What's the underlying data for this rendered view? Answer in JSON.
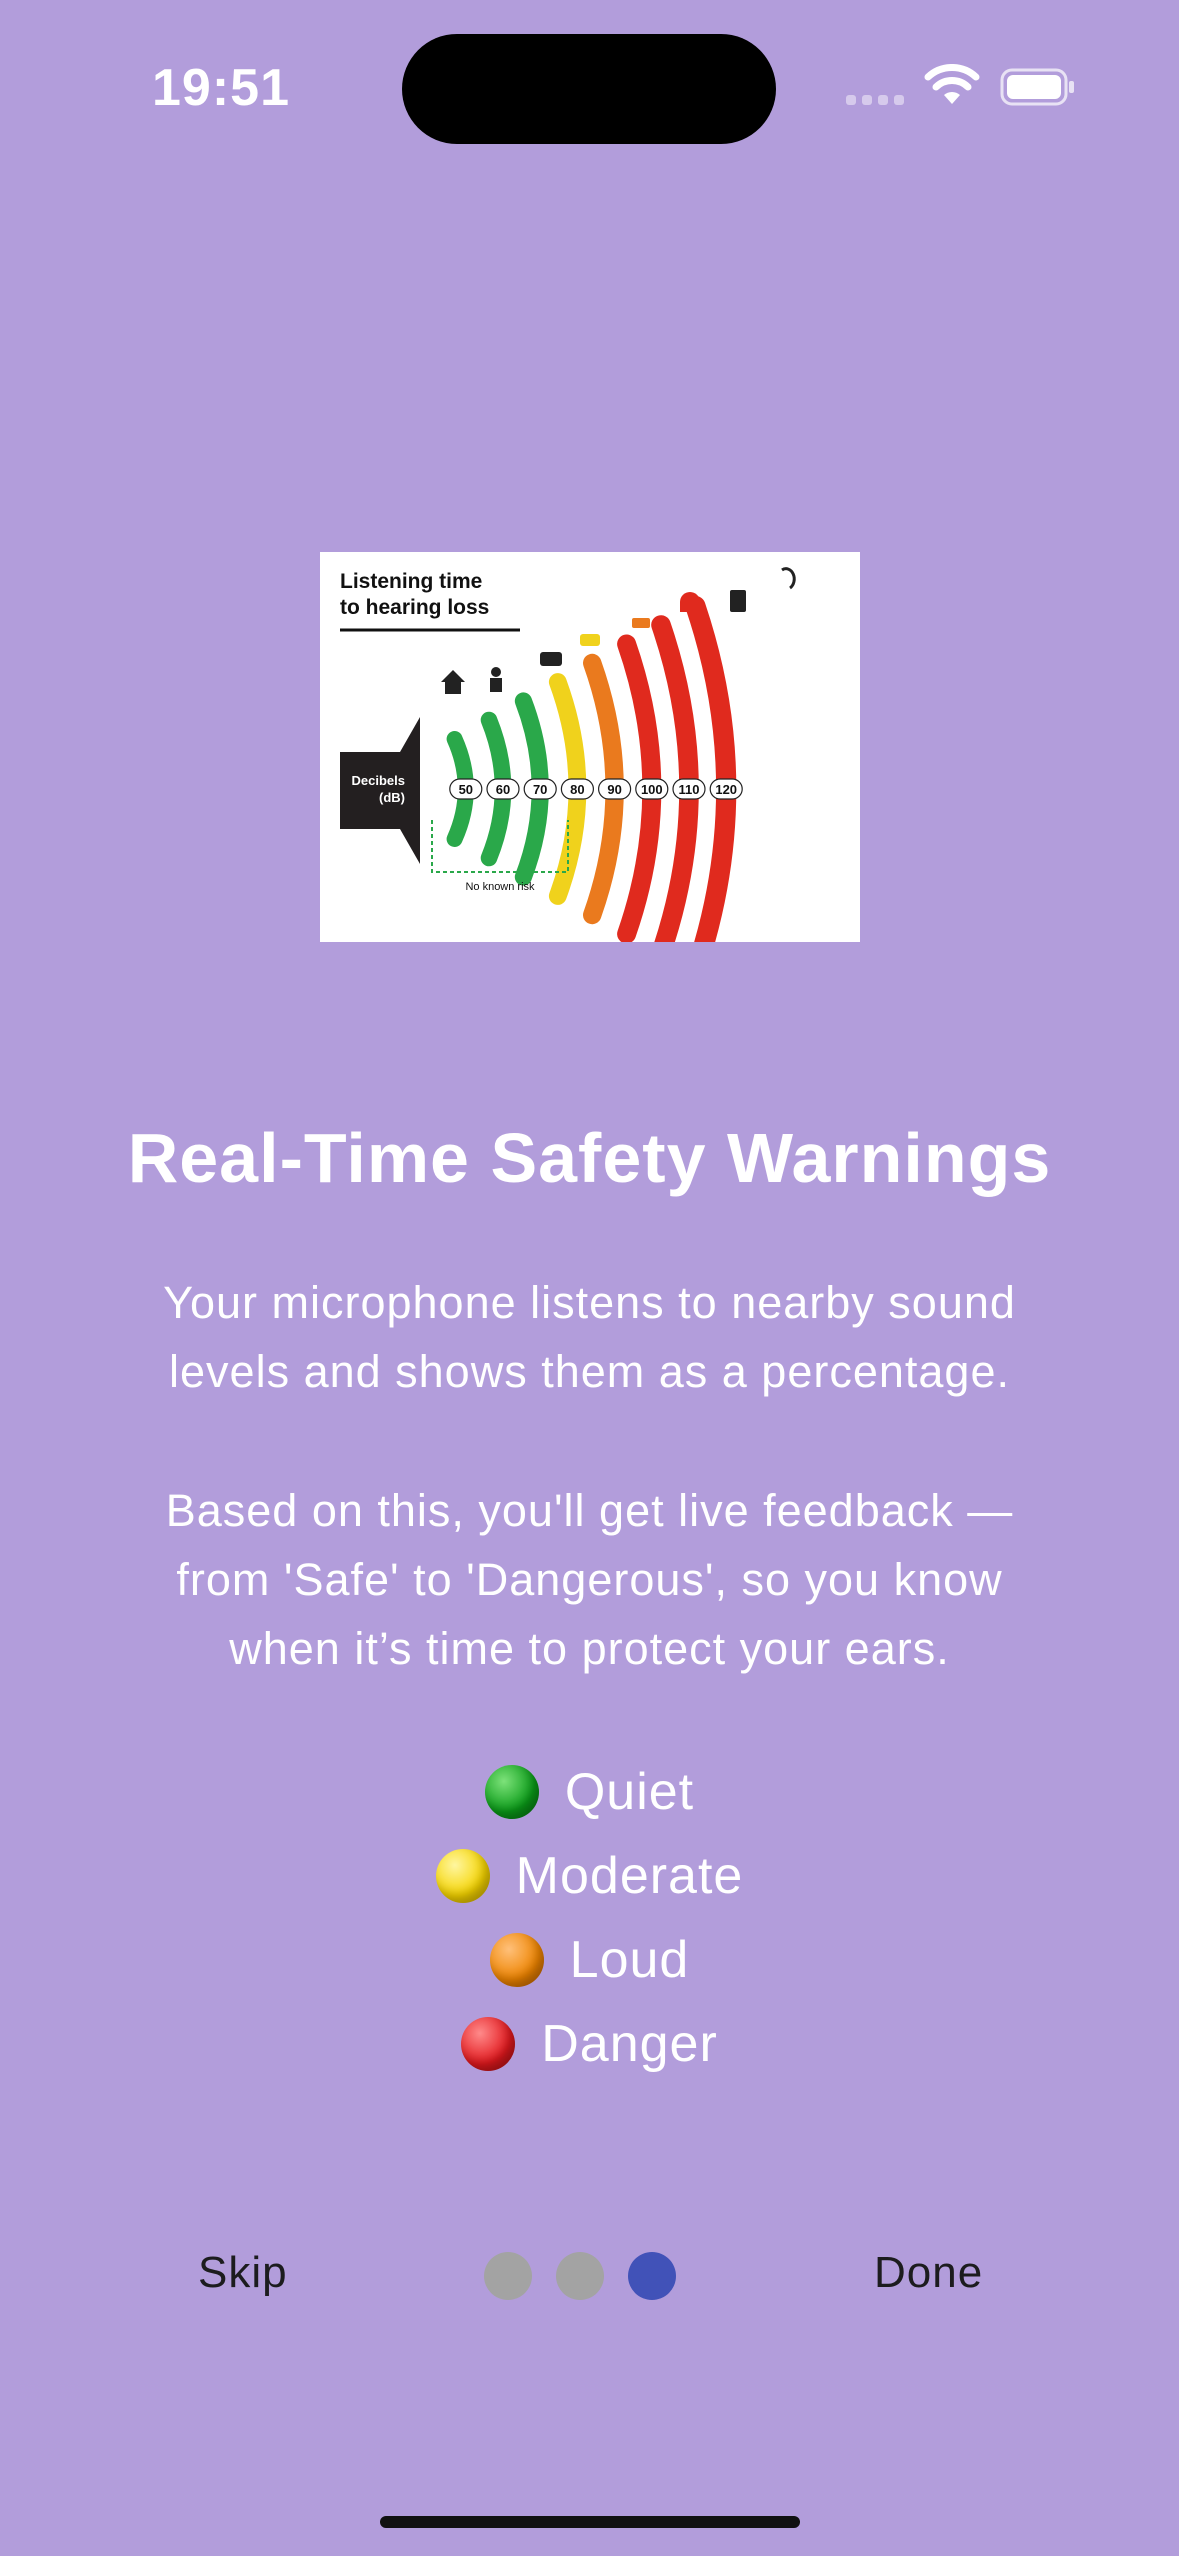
{
  "status_bar": {
    "time": "19:51"
  },
  "infographic": {
    "title_line1": "Listening time",
    "title_line2": "to hearing loss",
    "decibels_label_line1": "Decibels",
    "decibels_label_line2": "(dB)",
    "levels": [
      "50",
      "60",
      "70",
      "80",
      "90",
      "100",
      "110",
      "120"
    ],
    "no_risk_label": "No known risk",
    "colors": [
      "#2aa84a",
      "#2aa84a",
      "#2aa84a",
      "#f0d21c",
      "#ea7a1e",
      "#e02a1e",
      "#e02a1e",
      "#e02a1e"
    ]
  },
  "content": {
    "title": "Real-Time Safety Warnings",
    "paragraph1_line1": "Your microphone listens to nearby sound",
    "paragraph1_line2": "levels and shows them as a percentage.",
    "paragraph2_line1": "Based on this, you'll get live feedback —",
    "paragraph2_line2": "from 'Safe' to 'Dangerous', so you know",
    "paragraph2_line3": "when it’s time to protect your ears."
  },
  "levels": [
    {
      "label": "Quiet",
      "color": "green"
    },
    {
      "label": "Moderate",
      "color": "yellow"
    },
    {
      "label": "Loud",
      "color": "orange"
    },
    {
      "label": "Danger",
      "color": "red"
    }
  ],
  "footer": {
    "skip_label": "Skip",
    "done_label": "Done",
    "page_count": 3,
    "active_page": 3
  }
}
